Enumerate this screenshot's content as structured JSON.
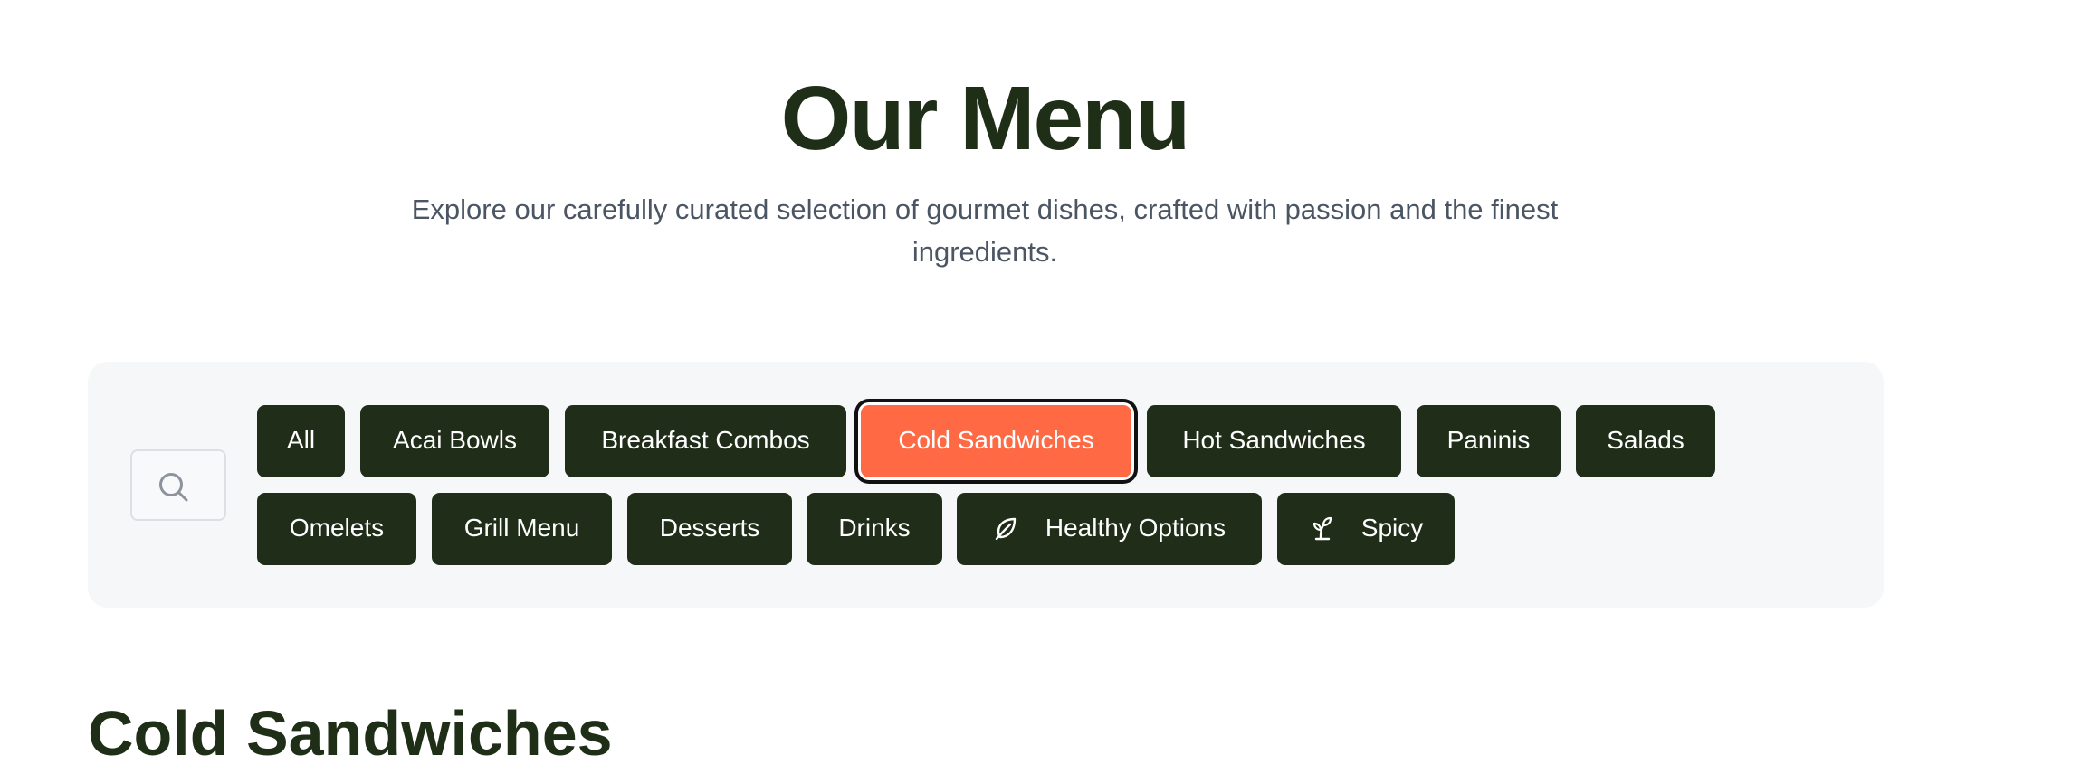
{
  "header": {
    "title": "Our Menu",
    "subtitle": "Explore our carefully curated selection of gourmet dishes, crafted with passion and the finest ingredients."
  },
  "search": {
    "icon": "search-icon",
    "placeholder": ""
  },
  "filters": {
    "active_index": 3,
    "active_color": "#ff6a45",
    "chip_color": "#202e19",
    "items": [
      {
        "label": "All"
      },
      {
        "label": "Acai Bowls"
      },
      {
        "label": "Breakfast Combos"
      },
      {
        "label": "Cold Sandwiches"
      },
      {
        "label": "Hot Sandwiches"
      },
      {
        "label": "Paninis"
      },
      {
        "label": "Salads"
      },
      {
        "label": "Omelets"
      },
      {
        "label": "Grill Menu"
      },
      {
        "label": "Desserts"
      },
      {
        "label": "Drinks"
      },
      {
        "label": "Healthy Options",
        "icon": "leaf-icon"
      },
      {
        "label": "Spicy",
        "icon": "sprout-icon"
      }
    ]
  },
  "section": {
    "title": "Cold Sandwiches"
  }
}
